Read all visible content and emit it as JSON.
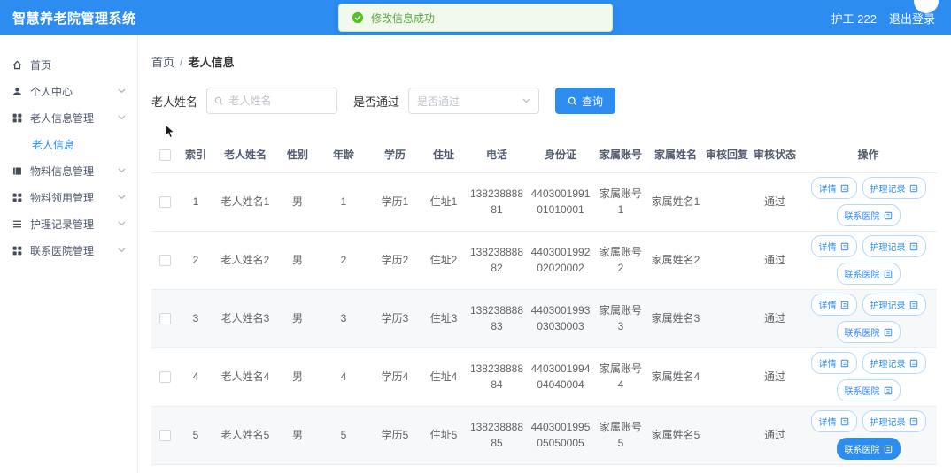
{
  "accent_color": "#2d8cf0",
  "header": {
    "title": "智慧养老院管理系统",
    "user_label": "护工 222",
    "logout_label": "退出登录"
  },
  "toast": {
    "message": "修改信息成功",
    "icon": "check-circle",
    "success_color": "#52c41a"
  },
  "sidebar": {
    "items": [
      {
        "label": "首页",
        "icon": "home",
        "expandable": false
      },
      {
        "label": "个人中心",
        "icon": "user",
        "expandable": true
      },
      {
        "label": "老人信息管理",
        "icon": "grid",
        "expandable": true,
        "children": [
          {
            "label": "老人信息",
            "active": true
          }
        ]
      },
      {
        "label": "物料信息管理",
        "icon": "package",
        "expandable": true
      },
      {
        "label": "物料领用管理",
        "icon": "grid",
        "expandable": true
      },
      {
        "label": "护理记录管理",
        "icon": "list",
        "expandable": true
      },
      {
        "label": "联系医院管理",
        "icon": "grid",
        "expandable": true
      }
    ]
  },
  "breadcrumb": {
    "home": "首页",
    "separator": "/",
    "current": "老人信息"
  },
  "filters": {
    "name_label": "老人姓名",
    "name_placeholder": "老人姓名",
    "pass_label": "是否通过",
    "pass_placeholder": "是否通过",
    "search_button": "查询"
  },
  "table": {
    "columns": [
      "索引",
      "老人姓名",
      "性别",
      "年龄",
      "学历",
      "住址",
      "电话",
      "身份证",
      "家属账号",
      "家属姓名",
      "审核回复",
      "审核状态",
      "操作"
    ],
    "actions": [
      "详情",
      "护理记录",
      "联系医院"
    ],
    "rows": [
      {
        "index": "1",
        "name": "老人姓名1",
        "gender": "男",
        "age": "1",
        "education": "学历1",
        "address": "住址1",
        "phone": "13823888881",
        "id_card": "440300199101010001",
        "family_account": "家属账号1",
        "family_name": "家属姓名1",
        "review_reply": "",
        "review_status": "通过"
      },
      {
        "index": "2",
        "name": "老人姓名2",
        "gender": "男",
        "age": "2",
        "education": "学历2",
        "address": "住址2",
        "phone": "13823888882",
        "id_card": "440300199202020002",
        "family_account": "家属账号2",
        "family_name": "家属姓名2",
        "review_reply": "",
        "review_status": "通过"
      },
      {
        "index": "3",
        "name": "老人姓名3",
        "gender": "男",
        "age": "3",
        "education": "学历3",
        "address": "住址3",
        "phone": "13823888883",
        "id_card": "440300199303030003",
        "family_account": "家属账号3",
        "family_name": "家属姓名3",
        "review_reply": "",
        "review_status": "通过"
      },
      {
        "index": "4",
        "name": "老人姓名4",
        "gender": "男",
        "age": "4",
        "education": "学历4",
        "address": "住址4",
        "phone": "13823888884",
        "id_card": "440300199404040004",
        "family_account": "家属账号4",
        "family_name": "家属姓名4",
        "review_reply": "",
        "review_status": "通过"
      },
      {
        "index": "5",
        "name": "老人姓名5",
        "gender": "男",
        "age": "5",
        "education": "学历5",
        "address": "住址5",
        "phone": "13823888885",
        "id_card": "440300199505050005",
        "family_account": "家属账号5",
        "family_name": "家属姓名5",
        "review_reply": "",
        "review_status": "通过",
        "highlight_action": 2
      }
    ]
  }
}
